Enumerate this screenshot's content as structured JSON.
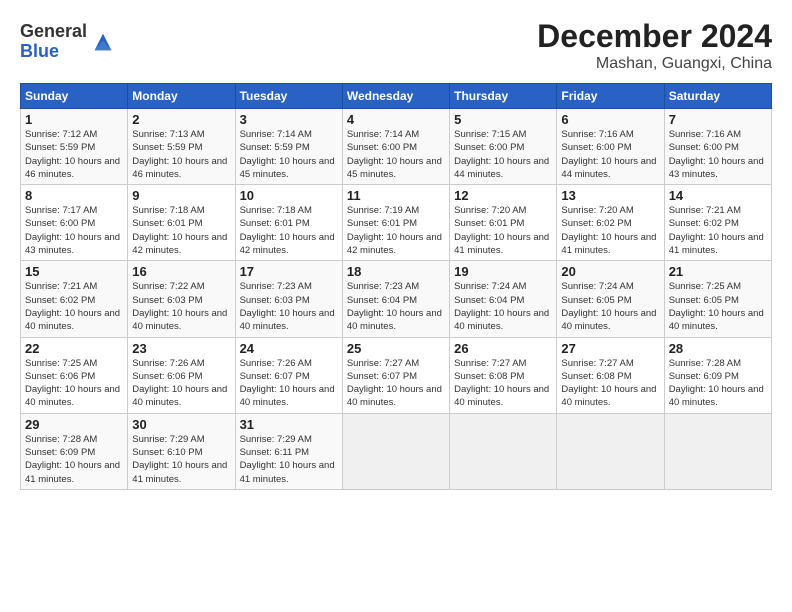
{
  "logo": {
    "text_general": "General",
    "text_blue": "Blue"
  },
  "title": "December 2024",
  "subtitle": "Mashan, Guangxi, China",
  "header": {
    "days": [
      "Sunday",
      "Monday",
      "Tuesday",
      "Wednesday",
      "Thursday",
      "Friday",
      "Saturday"
    ]
  },
  "weeks": [
    [
      {
        "day": "1",
        "sunrise": "7:12 AM",
        "sunset": "5:59 PM",
        "daylight": "10 hours and 46 minutes."
      },
      {
        "day": "2",
        "sunrise": "7:13 AM",
        "sunset": "5:59 PM",
        "daylight": "10 hours and 46 minutes."
      },
      {
        "day": "3",
        "sunrise": "7:14 AM",
        "sunset": "5:59 PM",
        "daylight": "10 hours and 45 minutes."
      },
      {
        "day": "4",
        "sunrise": "7:14 AM",
        "sunset": "6:00 PM",
        "daylight": "10 hours and 45 minutes."
      },
      {
        "day": "5",
        "sunrise": "7:15 AM",
        "sunset": "6:00 PM",
        "daylight": "10 hours and 44 minutes."
      },
      {
        "day": "6",
        "sunrise": "7:16 AM",
        "sunset": "6:00 PM",
        "daylight": "10 hours and 44 minutes."
      },
      {
        "day": "7",
        "sunrise": "7:16 AM",
        "sunset": "6:00 PM",
        "daylight": "10 hours and 43 minutes."
      }
    ],
    [
      {
        "day": "8",
        "sunrise": "7:17 AM",
        "sunset": "6:00 PM",
        "daylight": "10 hours and 43 minutes."
      },
      {
        "day": "9",
        "sunrise": "7:18 AM",
        "sunset": "6:01 PM",
        "daylight": "10 hours and 42 minutes."
      },
      {
        "day": "10",
        "sunrise": "7:18 AM",
        "sunset": "6:01 PM",
        "daylight": "10 hours and 42 minutes."
      },
      {
        "day": "11",
        "sunrise": "7:19 AM",
        "sunset": "6:01 PM",
        "daylight": "10 hours and 42 minutes."
      },
      {
        "day": "12",
        "sunrise": "7:20 AM",
        "sunset": "6:01 PM",
        "daylight": "10 hours and 41 minutes."
      },
      {
        "day": "13",
        "sunrise": "7:20 AM",
        "sunset": "6:02 PM",
        "daylight": "10 hours and 41 minutes."
      },
      {
        "day": "14",
        "sunrise": "7:21 AM",
        "sunset": "6:02 PM",
        "daylight": "10 hours and 41 minutes."
      }
    ],
    [
      {
        "day": "15",
        "sunrise": "7:21 AM",
        "sunset": "6:02 PM",
        "daylight": "10 hours and 40 minutes."
      },
      {
        "day": "16",
        "sunrise": "7:22 AM",
        "sunset": "6:03 PM",
        "daylight": "10 hours and 40 minutes."
      },
      {
        "day": "17",
        "sunrise": "7:23 AM",
        "sunset": "6:03 PM",
        "daylight": "10 hours and 40 minutes."
      },
      {
        "day": "18",
        "sunrise": "7:23 AM",
        "sunset": "6:04 PM",
        "daylight": "10 hours and 40 minutes."
      },
      {
        "day": "19",
        "sunrise": "7:24 AM",
        "sunset": "6:04 PM",
        "daylight": "10 hours and 40 minutes."
      },
      {
        "day": "20",
        "sunrise": "7:24 AM",
        "sunset": "6:05 PM",
        "daylight": "10 hours and 40 minutes."
      },
      {
        "day": "21",
        "sunrise": "7:25 AM",
        "sunset": "6:05 PM",
        "daylight": "10 hours and 40 minutes."
      }
    ],
    [
      {
        "day": "22",
        "sunrise": "7:25 AM",
        "sunset": "6:06 PM",
        "daylight": "10 hours and 40 minutes."
      },
      {
        "day": "23",
        "sunrise": "7:26 AM",
        "sunset": "6:06 PM",
        "daylight": "10 hours and 40 minutes."
      },
      {
        "day": "24",
        "sunrise": "7:26 AM",
        "sunset": "6:07 PM",
        "daylight": "10 hours and 40 minutes."
      },
      {
        "day": "25",
        "sunrise": "7:27 AM",
        "sunset": "6:07 PM",
        "daylight": "10 hours and 40 minutes."
      },
      {
        "day": "26",
        "sunrise": "7:27 AM",
        "sunset": "6:08 PM",
        "daylight": "10 hours and 40 minutes."
      },
      {
        "day": "27",
        "sunrise": "7:27 AM",
        "sunset": "6:08 PM",
        "daylight": "10 hours and 40 minutes."
      },
      {
        "day": "28",
        "sunrise": "7:28 AM",
        "sunset": "6:09 PM",
        "daylight": "10 hours and 40 minutes."
      }
    ],
    [
      {
        "day": "29",
        "sunrise": "7:28 AM",
        "sunset": "6:09 PM",
        "daylight": "10 hours and 41 minutes."
      },
      {
        "day": "30",
        "sunrise": "7:29 AM",
        "sunset": "6:10 PM",
        "daylight": "10 hours and 41 minutes."
      },
      {
        "day": "31",
        "sunrise": "7:29 AM",
        "sunset": "6:11 PM",
        "daylight": "10 hours and 41 minutes."
      },
      null,
      null,
      null,
      null
    ]
  ]
}
